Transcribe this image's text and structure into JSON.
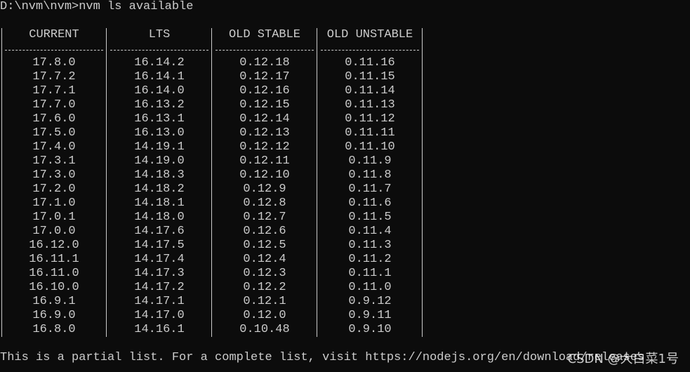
{
  "console": {
    "prompt_line": "D:\\nvm\\nvm>nvm ls available",
    "footer_line": "This is a partial list. For a complete list, visit https://nodejs.org/en/download/releases",
    "watermark": "CSDN @大白菜1号"
  },
  "table": {
    "headers": [
      "CURRENT",
      "LTS",
      "OLD STABLE",
      "OLD UNSTABLE"
    ],
    "columns": [
      [
        "17.8.0",
        "17.7.2",
        "17.7.1",
        "17.7.0",
        "17.6.0",
        "17.5.0",
        "17.4.0",
        "17.3.1",
        "17.3.0",
        "17.2.0",
        "17.1.0",
        "17.0.1",
        "17.0.0",
        "16.12.0",
        "16.11.1",
        "16.11.0",
        "16.10.0",
        "16.9.1",
        "16.9.0",
        "16.8.0"
      ],
      [
        "16.14.2",
        "16.14.1",
        "16.14.0",
        "16.13.2",
        "16.13.1",
        "16.13.0",
        "14.19.1",
        "14.19.0",
        "14.18.3",
        "14.18.2",
        "14.18.1",
        "14.18.0",
        "14.17.6",
        "14.17.5",
        "14.17.4",
        "14.17.3",
        "14.17.2",
        "14.17.1",
        "14.17.0",
        "14.16.1"
      ],
      [
        "0.12.18",
        "0.12.17",
        "0.12.16",
        "0.12.15",
        "0.12.14",
        "0.12.13",
        "0.12.12",
        "0.12.11",
        "0.12.10",
        "0.12.9",
        "0.12.8",
        "0.12.7",
        "0.12.6",
        "0.12.5",
        "0.12.4",
        "0.12.3",
        "0.12.2",
        "0.12.1",
        "0.12.0",
        "0.10.48"
      ],
      [
        "0.11.16",
        "0.11.15",
        "0.11.14",
        "0.11.13",
        "0.11.12",
        "0.11.11",
        "0.11.10",
        "0.11.9",
        "0.11.8",
        "0.11.7",
        "0.11.6",
        "0.11.5",
        "0.11.4",
        "0.11.3",
        "0.11.2",
        "0.11.1",
        "0.11.0",
        "0.9.12",
        "0.9.11",
        "0.9.10"
      ]
    ]
  },
  "colors": {
    "background": "#0c0c0c",
    "text": "#cccccc"
  }
}
